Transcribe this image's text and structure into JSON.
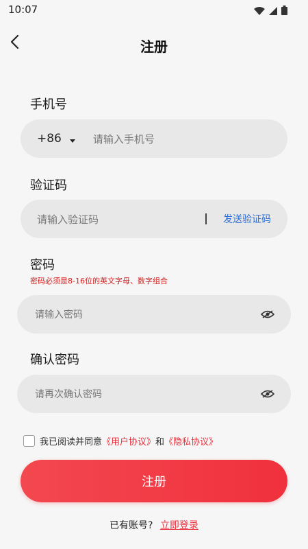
{
  "status_bar": {
    "time": "10:07"
  },
  "header": {
    "title": "注册"
  },
  "phone": {
    "label": "手机号",
    "country_code": "+86",
    "placeholder": "请输入手机号"
  },
  "code": {
    "label": "验证码",
    "placeholder": "请输入验证码",
    "send_label": "发送验证码"
  },
  "password": {
    "label": "密码",
    "hint": "密码必须是8-16位的英文字母、数字组合",
    "placeholder": "请输入密码"
  },
  "confirm": {
    "label": "确认密码",
    "placeholder": "请再次确认密码"
  },
  "agreement": {
    "prefix": "我已阅读并同意",
    "user_agreement": "《用户协议》",
    "and": "和",
    "privacy_agreement": "《隐私协议》"
  },
  "submit": {
    "label": "注册"
  },
  "login": {
    "prompt": "已有账号?",
    "link": "立即登录"
  }
}
